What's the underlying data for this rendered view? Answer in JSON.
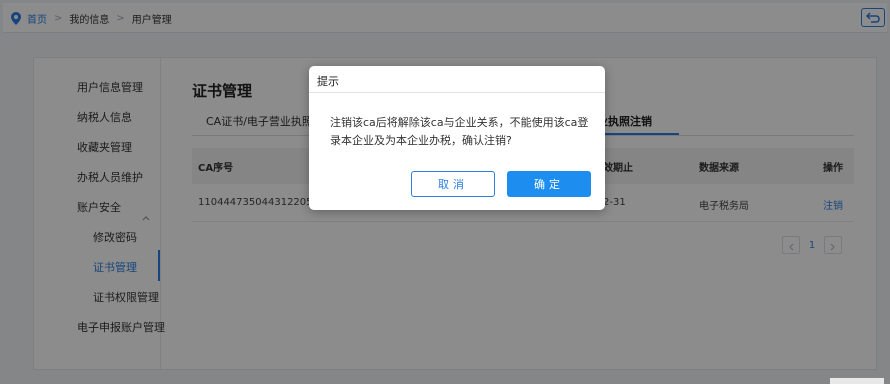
{
  "breadcrumb": {
    "home": "首页",
    "sep1": ">",
    "level1": "我的信息",
    "sep2": ">",
    "level2": "用户管理"
  },
  "sidebar": {
    "items": [
      {
        "label": "用户信息管理"
      },
      {
        "label": "纳税人信息"
      },
      {
        "label": "收藏夹管理"
      },
      {
        "label": "办税人员维护"
      },
      {
        "label": "账户安全"
      },
      {
        "label": "修改密码"
      },
      {
        "label": "证书管理"
      },
      {
        "label": "证书权限管理"
      },
      {
        "label": "电子申报账户管理"
      }
    ]
  },
  "main": {
    "title": "证书管理",
    "tabs": [
      {
        "label": "CA证书/电子营业执照"
      },
      {
        "label": "业执照注销"
      }
    ]
  },
  "table": {
    "headers": [
      "CA序号",
      "效期止",
      "数据来源",
      "操作"
    ],
    "rows": [
      {
        "ca_no": "110444735044312205...",
        "expiry": "2-31",
        "source": "电子税务局",
        "action": "注销"
      }
    ]
  },
  "pager": {
    "prev": "<",
    "page": "1",
    "next": ">"
  },
  "dialog": {
    "title": "提示",
    "message": "注销该ca后将解除该ca与企业关系，不能使用该ca登录本企业及为本企业办税，确认注销?",
    "cancel": "取消",
    "confirm": "确定"
  },
  "colors": {
    "accent": "#2d7fe0",
    "confirm_button": "#1d8ef0",
    "overlay": "rgba(0,0,0,0.45)"
  }
}
